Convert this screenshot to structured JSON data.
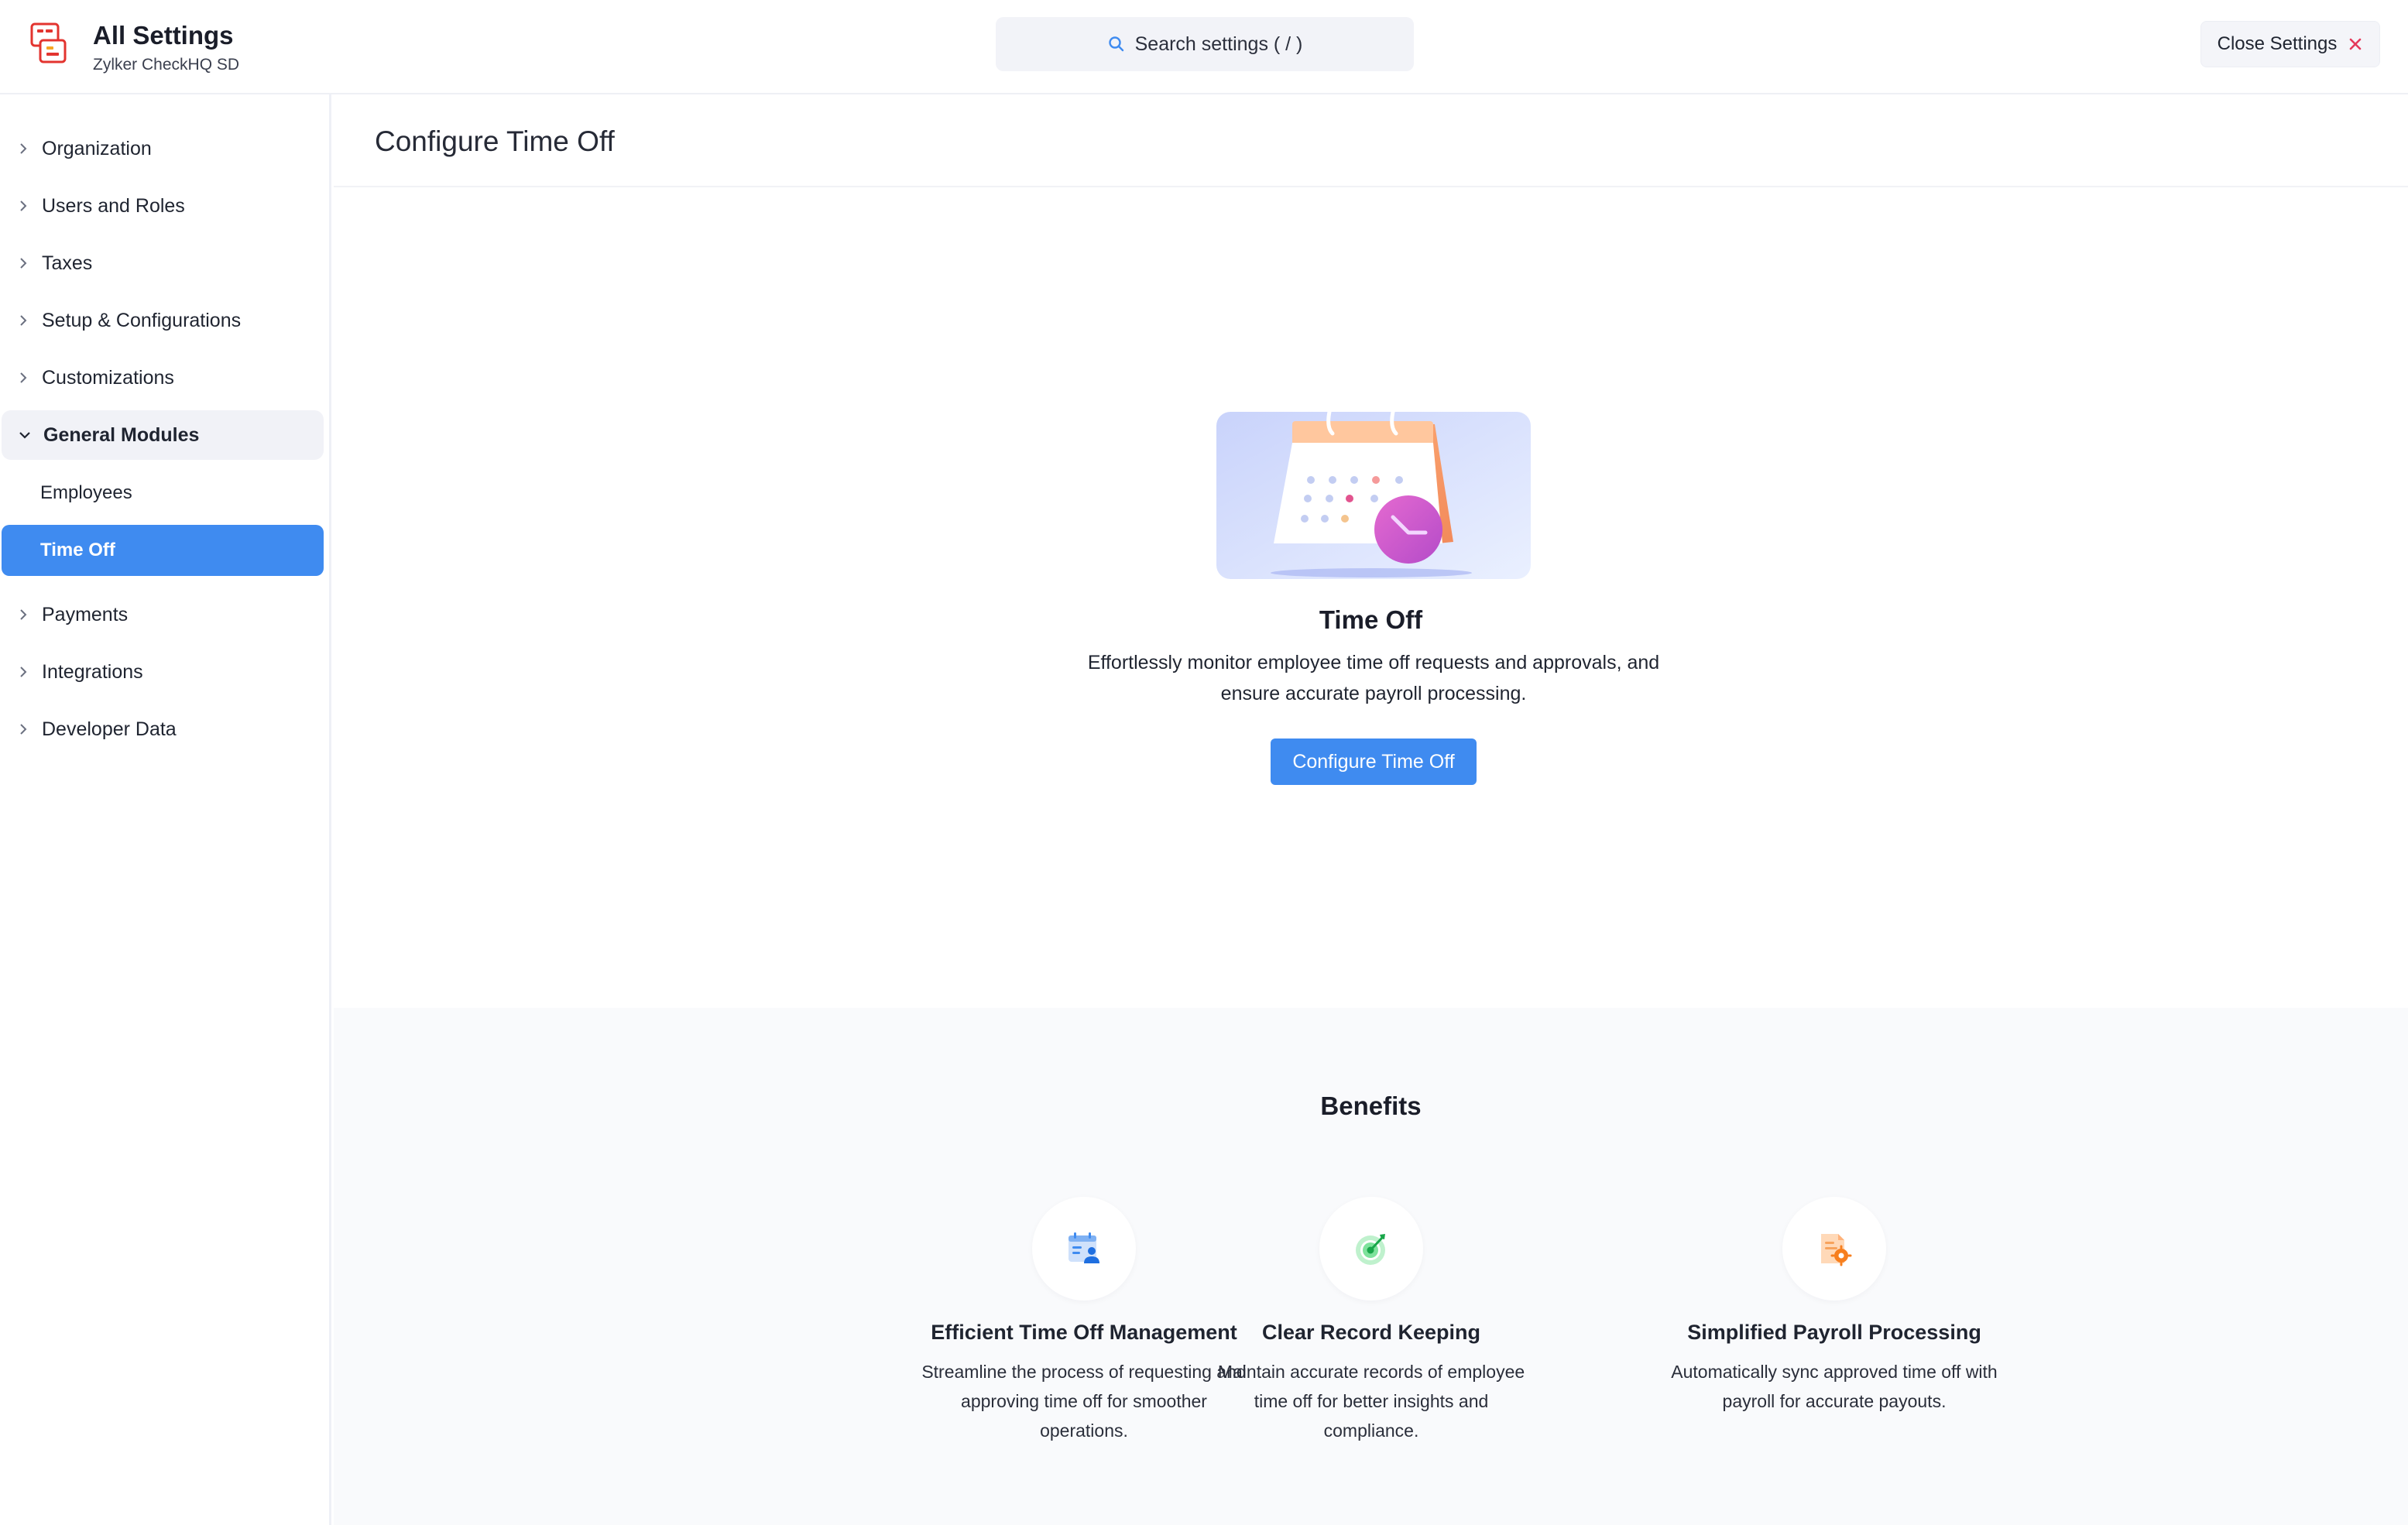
{
  "header": {
    "title": "All Settings",
    "subtitle": "Zylker CheckHQ SD",
    "search_placeholder": "Search settings ( / )",
    "close_label": "Close Settings"
  },
  "sidebar": {
    "items": [
      {
        "label": "Organization",
        "state": "collapsed"
      },
      {
        "label": "Users and Roles",
        "state": "collapsed"
      },
      {
        "label": "Taxes",
        "state": "collapsed"
      },
      {
        "label": "Setup & Configurations",
        "state": "collapsed"
      },
      {
        "label": "Customizations",
        "state": "collapsed"
      },
      {
        "label": "General Modules",
        "state": "expanded"
      },
      {
        "label": "Payments",
        "state": "collapsed"
      },
      {
        "label": "Integrations",
        "state": "collapsed"
      },
      {
        "label": "Developer Data",
        "state": "collapsed"
      }
    ],
    "subitems": [
      {
        "label": "Employees",
        "active": false
      },
      {
        "label": "Time Off",
        "active": true
      }
    ]
  },
  "main": {
    "page_title": "Configure Time Off",
    "hero": {
      "title": "Time Off",
      "description": "Effortlessly monitor employee time off requests and approvals, and ensure accurate payroll processing.",
      "cta_label": "Configure Time Off"
    },
    "benefits": {
      "title": "Benefits",
      "items": [
        {
          "icon": "calendar-user-icon",
          "title": "Efficient Time Off Management",
          "description": "Streamline the process of requesting and approving time off for smoother operations."
        },
        {
          "icon": "target-icon",
          "title": "Clear Record Keeping",
          "description": "Maintain accurate records of employee time off for better insights and compliance."
        },
        {
          "icon": "document-gear-icon",
          "title": "Simplified Payroll Processing",
          "description": "Automatically sync approved time off with payroll for accurate payouts."
        }
      ]
    }
  },
  "colors": {
    "accent": "#3f8bf0",
    "close_x": "#e5395a",
    "sidebar_expanded_bg": "#f1f2f7",
    "benefits_bg": "#f9fafc"
  }
}
